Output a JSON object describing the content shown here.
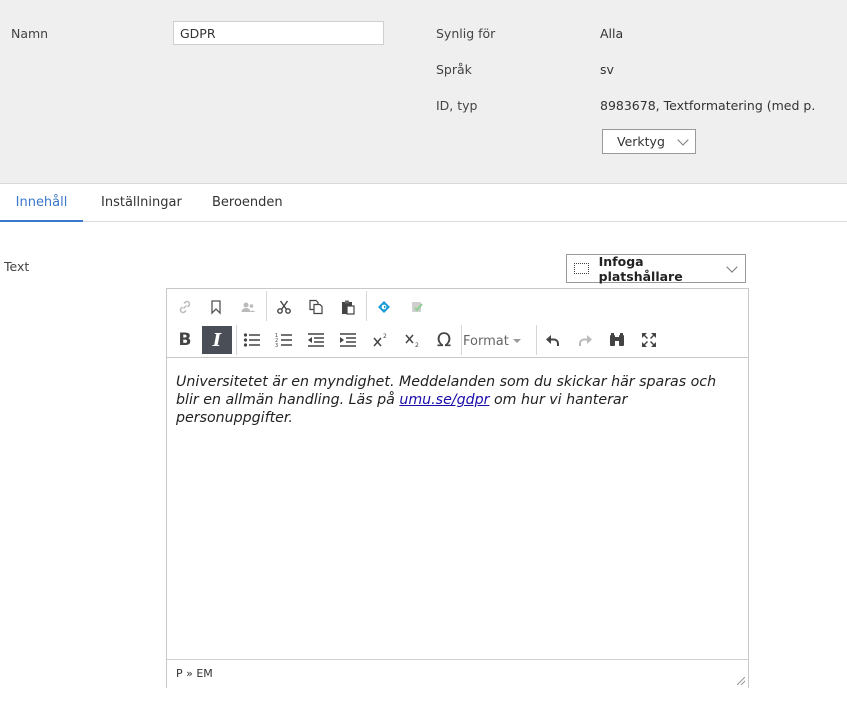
{
  "header": {
    "name_label": "Namn",
    "name_value": "GDPR",
    "visible_label": "Synlig för",
    "visible_value": "Alla",
    "language_label": "Språk",
    "language_value": "sv",
    "id_label": "ID, typ",
    "id_value": "8983678, Textformatering (med p...",
    "tools_button": "Verktyg"
  },
  "tabs": [
    {
      "label": "Innehåll",
      "active": true
    },
    {
      "label": "Inställningar",
      "active": false
    },
    {
      "label": "Beroenden",
      "active": false
    }
  ],
  "field": {
    "label": "Text",
    "insert_placeholder_button": "Infoga platshållare"
  },
  "editor": {
    "toolbar_row1": [
      "link-icon",
      "anchor-icon",
      "user-icon",
      "cut-icon",
      "copy-icon",
      "paste-icon",
      "insert-link-icon",
      "spellcheck-icon"
    ],
    "toolbar_row2": [
      "bold-icon",
      "italic-icon",
      "bulleted-list-icon",
      "numbered-list-icon",
      "outdent-icon",
      "indent-icon",
      "superscript-icon",
      "subscript-icon",
      "special-char-icon",
      "undo-icon",
      "redo-icon",
      "find-icon",
      "maximize-icon"
    ],
    "bold_label": "B",
    "italic_label": "I",
    "special_char": "Ω",
    "format_label": "Format",
    "content_before": "Universitetet är en myndighet. Meddelanden som du skickar här sparas och blir en allmän handling. Läs på ",
    "content_link": "umu.se/gdpr",
    "content_after": " om hur vi hanterar personuppgifter.",
    "element_path": "P » EM"
  },
  "colors": {
    "header_bg": "#efeff0",
    "tab_active": "#3a78c9",
    "link": "#1a0dab",
    "pressed_button": "#4a4f57",
    "accent_icon": "#1a9bd7"
  }
}
